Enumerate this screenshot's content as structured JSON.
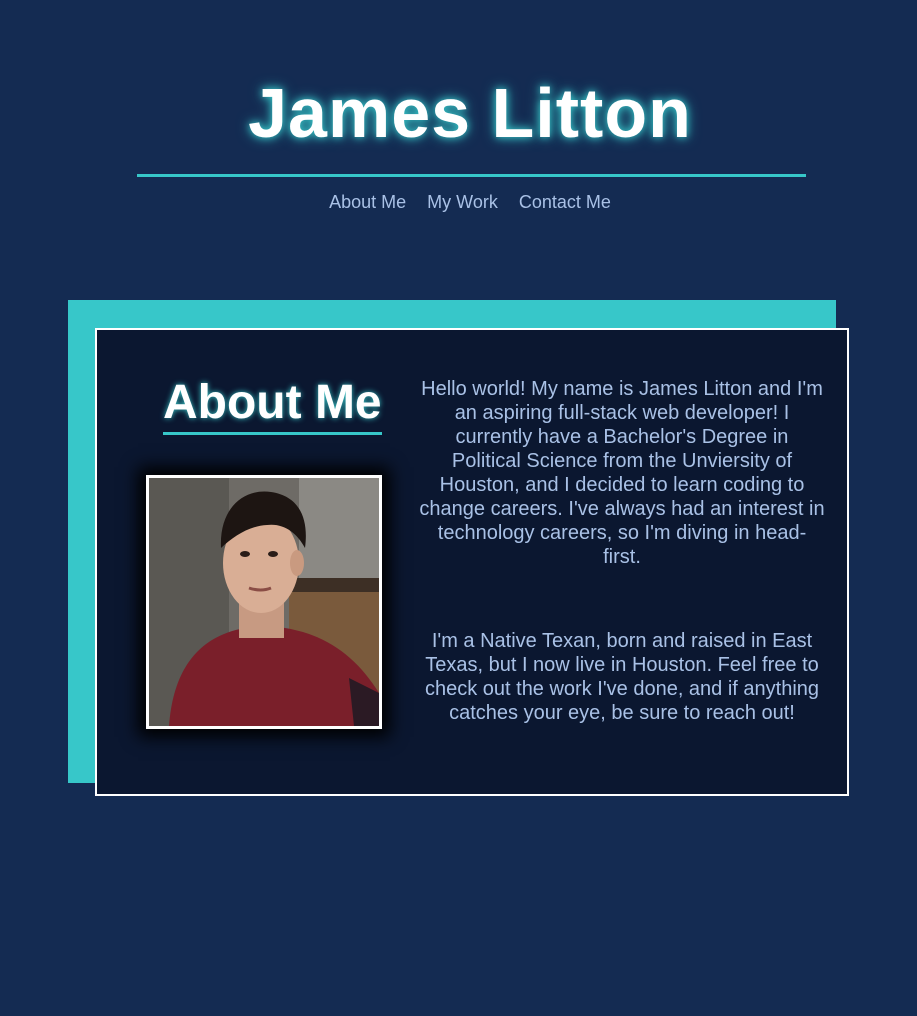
{
  "header": {
    "title": "James Litton"
  },
  "nav": {
    "items": [
      "About Me",
      "My Work",
      "Contact Me"
    ]
  },
  "about": {
    "heading": "About Me",
    "portrait_alt": "portrait-photo",
    "paragraphs": [
      "Hello world! My name is James Litton and I'm an aspiring full-stack web developer! I currently have a Bachelor's Degree in Political Science from the Unviersity of Houston, and I decided to learn coding to change careers. I've always had an interest in technology careers, so I'm diving in head-first.",
      "I'm a Native Texan, born and raised in East Texas, but I now live in Houston. Feel free to check out the work I've done, and if anything catches your eye, be sure to reach out!"
    ]
  },
  "colors": {
    "background": "#142b52",
    "accent": "#37c7c9",
    "card": "#0b1730",
    "text": "#a9c1e6"
  }
}
